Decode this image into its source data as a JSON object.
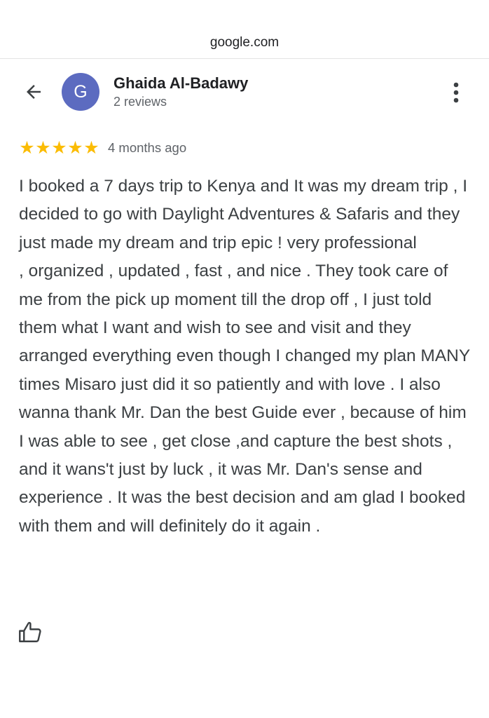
{
  "browser": {
    "url": "google.com"
  },
  "reviewer": {
    "initial": "G",
    "name": "Ghaida Al-Badawy",
    "review_count": "2 reviews",
    "avatar_color": "#5c6bc0"
  },
  "rating": {
    "stars": 5,
    "max": 5,
    "time_ago": "4 months ago",
    "star_color": "#fbbc04"
  },
  "review": {
    "text": "I booked a 7 days trip to Kenya and It was my dream trip , I decided to go with Daylight Adventures & Safaris and they just made my dream and trip epic ! very professional\n, organized , updated , fast , and nice . They took care of me from the pick up moment till the drop off , I just told them what I want and wish to see and visit and they arranged everything even though I changed my plan MANY times Misaro just did it so patiently and with love . I also wanna thank Mr. Dan the best Guide ever , because of him I was able to see , get close ,and capture the best shots , and it wans't just by luck , it was Mr. Dan's sense and experience . It was the best decision and am glad I booked with them and will definitely do it again ."
  },
  "icons": {
    "back": "arrow-back-icon",
    "more": "more-vert-icon",
    "like": "thumb-up-icon"
  }
}
